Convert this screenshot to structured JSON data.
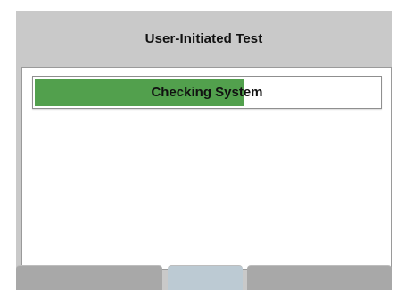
{
  "header": {
    "title": "User-Initiated Test"
  },
  "progress": {
    "label": "Checking System",
    "fraction": 0.61,
    "fill_color": "#52a04d"
  },
  "softkeys": [
    {
      "label": ""
    },
    {
      "label": ""
    },
    {
      "label": ""
    }
  ]
}
